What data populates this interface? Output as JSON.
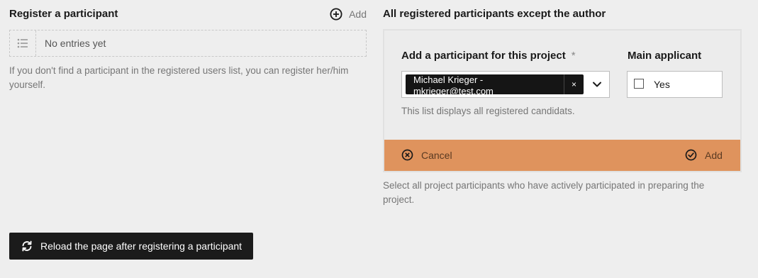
{
  "left": {
    "title": "Register a participant",
    "add_label": "Add",
    "entries_empty": "No entries yet",
    "hint": "If you don't find a participant in the registered users list, you can register her/him yourself.",
    "reload_label": "Reload the page after registering a participant"
  },
  "right": {
    "title": "All registered participants except the author",
    "participant_label": "Add a participant for this project",
    "required_mark": "*",
    "selected_chip": {
      "line1": "Michael Krieger -",
      "line2": "mkrieger@test.com",
      "remove": "×"
    },
    "main_applicant_label": "Main applicant",
    "checkbox_label": "Yes",
    "checkbox_checked": false,
    "select_hint": "This list displays all registered candidats.",
    "cancel_label": "Cancel",
    "add_label": "Add",
    "hint": "Select all project participants who have actively participated in preparing the project."
  },
  "colors": {
    "background": "#eeeeee",
    "footer_accent": "#df935d",
    "dark_button": "#1b1b1b"
  },
  "icons": {
    "add": "plus-circle-icon",
    "list": "list-icon",
    "reload": "refresh-icon",
    "remove": "close-icon",
    "dropdown": "chevron-down-icon",
    "cancel": "cancel-circle-icon",
    "confirm": "check-circle-icon"
  }
}
